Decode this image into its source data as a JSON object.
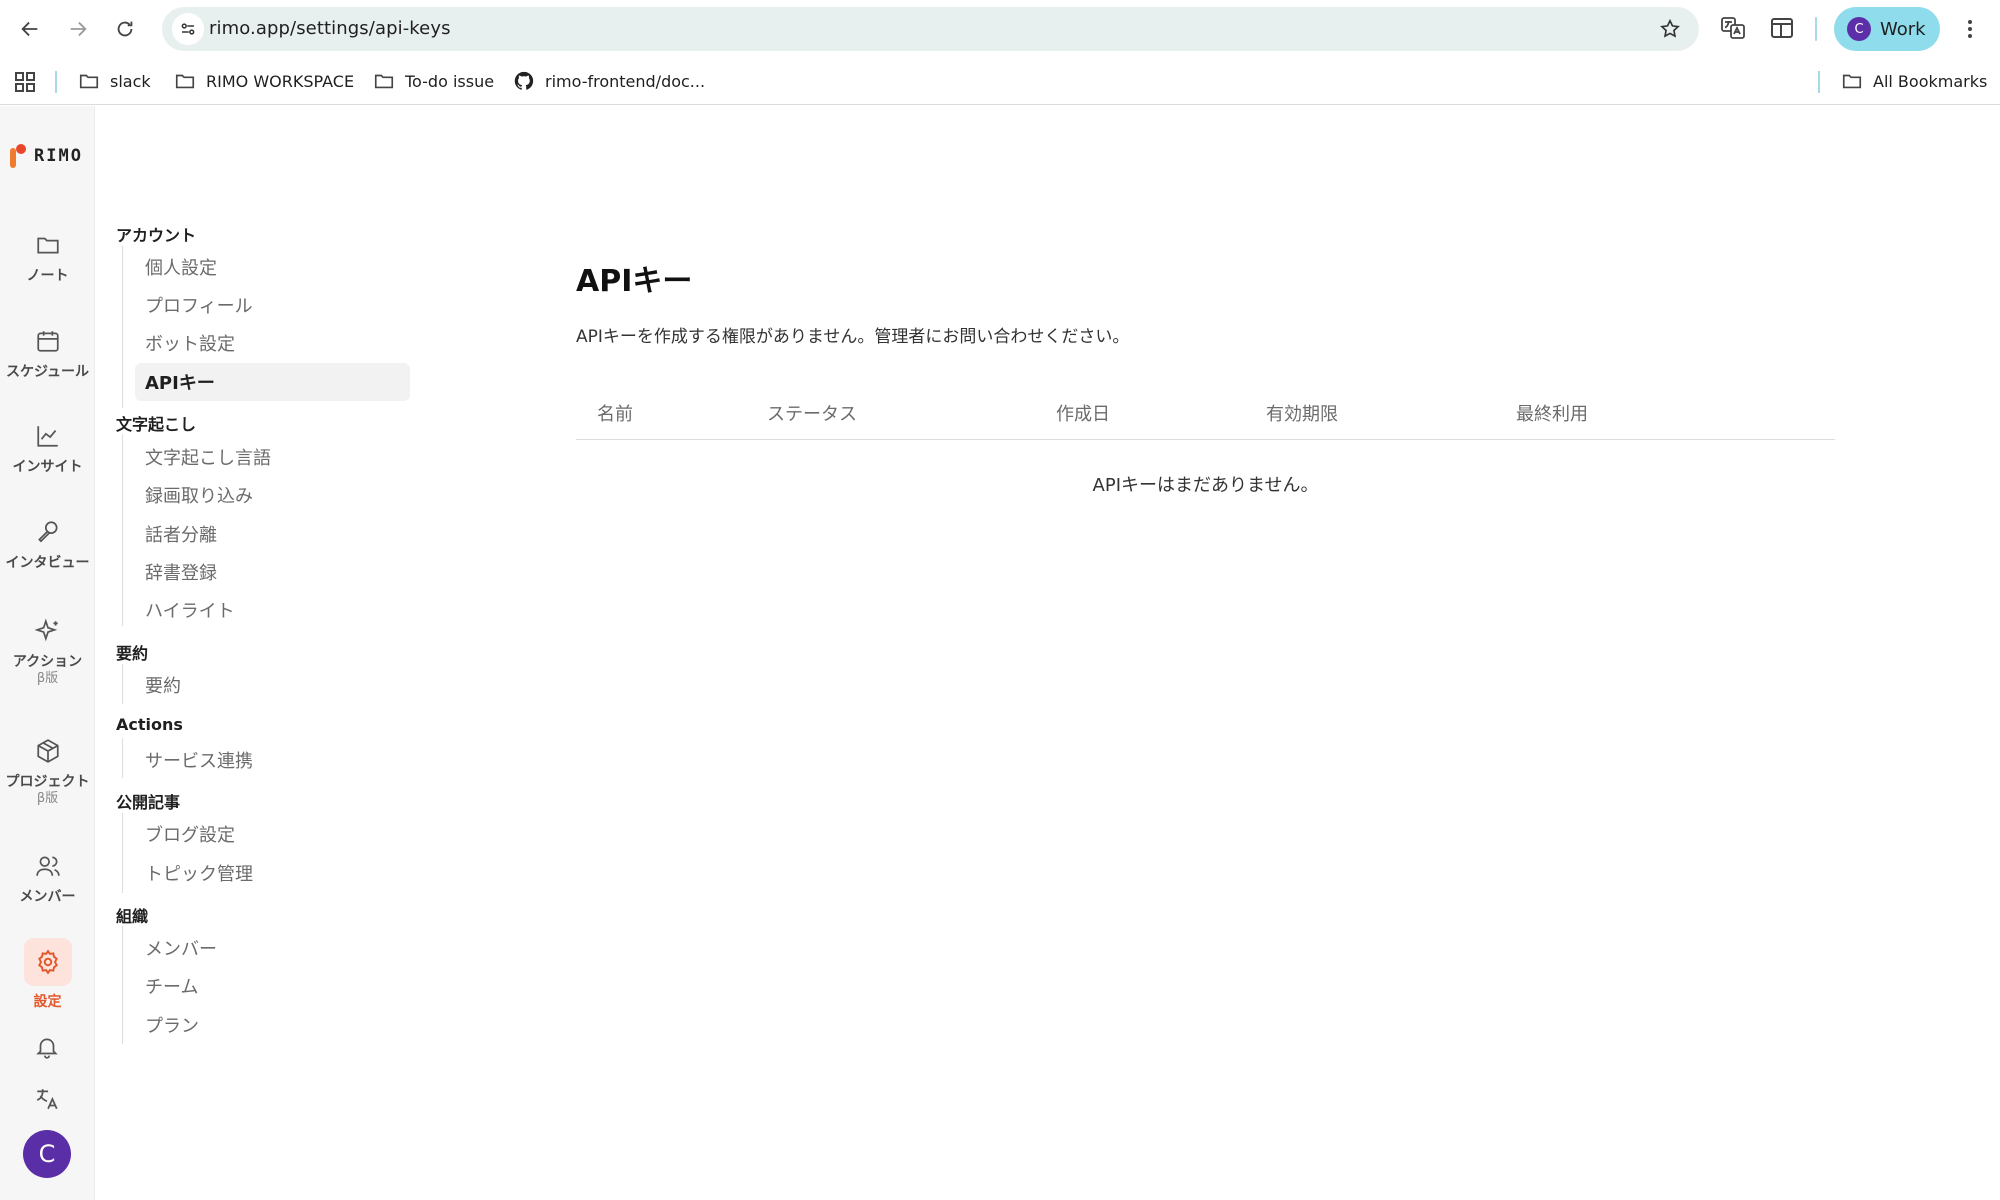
{
  "browser": {
    "url": "rimo.app/settings/api-keys",
    "profile_initial": "C",
    "profile_label": "Work",
    "bookmarks": [
      {
        "label": "slack",
        "icon": "folder-icon"
      },
      {
        "label": "RIMO WORKSPACE",
        "icon": "folder-icon"
      },
      {
        "label": "To-do issue",
        "icon": "folder-icon"
      },
      {
        "label": "rimo-frontend/doc...",
        "icon": "github-icon"
      }
    ],
    "all_bookmarks": "All Bookmarks"
  },
  "app": {
    "logo": "RIMO",
    "accent_color": "#e2572b",
    "rail": [
      {
        "label": "ノート",
        "icon": "folder-icon"
      },
      {
        "label": "スケジュール",
        "icon": "calendar-icon"
      },
      {
        "label": "インサイト",
        "icon": "chart-line-icon"
      },
      {
        "label": "インタビュー",
        "icon": "microphone-icon"
      },
      {
        "label": "アクション",
        "sub": "β版",
        "icon": "sparkles-icon"
      },
      {
        "label": "プロジェクト",
        "sub": "β版",
        "icon": "package-icon"
      },
      {
        "label": "メンバー",
        "icon": "users-icon"
      },
      {
        "label": "設定",
        "icon": "gear-icon",
        "active": true
      }
    ],
    "user_initial": "C"
  },
  "settings_nav": {
    "groups": [
      {
        "title": "アカウント",
        "items": [
          "個人設定",
          "プロフィール",
          "ボット設定",
          "APIキー"
        ]
      },
      {
        "title": "文字起こし",
        "items": [
          "文字起こし言語",
          "録画取り込み",
          "話者分離",
          "辞書登録",
          "ハイライト"
        ]
      },
      {
        "title": "要約",
        "items": [
          "要約"
        ]
      },
      {
        "title": "Actions",
        "items": [
          "サービス連携"
        ]
      },
      {
        "title": "公開記事",
        "items": [
          "ブログ設定",
          "トピック管理"
        ]
      },
      {
        "title": "組織",
        "items": [
          "メンバー",
          "チーム",
          "プラン"
        ]
      }
    ],
    "active_item": "APIキー"
  },
  "main": {
    "title": "APIキー",
    "description": "APIキーを作成する権限がありません。管理者にお問い合わせください。",
    "columns": [
      "名前",
      "ステータス",
      "作成日",
      "有効期限",
      "最終利用"
    ],
    "empty_message": "APIキーはまだありません。"
  }
}
